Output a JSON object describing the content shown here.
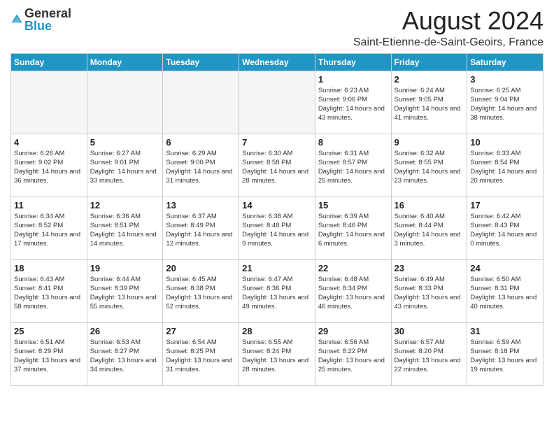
{
  "header": {
    "logo_general": "General",
    "logo_blue": "Blue",
    "month_title": "August 2024",
    "location": "Saint-Etienne-de-Saint-Geoirs, France"
  },
  "weekdays": [
    "Sunday",
    "Monday",
    "Tuesday",
    "Wednesday",
    "Thursday",
    "Friday",
    "Saturday"
  ],
  "weeks": [
    [
      {
        "day": "",
        "info": ""
      },
      {
        "day": "",
        "info": ""
      },
      {
        "day": "",
        "info": ""
      },
      {
        "day": "",
        "info": ""
      },
      {
        "day": "1",
        "info": "Sunrise: 6:23 AM\nSunset: 9:06 PM\nDaylight: 14 hours and 43 minutes."
      },
      {
        "day": "2",
        "info": "Sunrise: 6:24 AM\nSunset: 9:05 PM\nDaylight: 14 hours and 41 minutes."
      },
      {
        "day": "3",
        "info": "Sunrise: 6:25 AM\nSunset: 9:04 PM\nDaylight: 14 hours and 38 minutes."
      }
    ],
    [
      {
        "day": "4",
        "info": "Sunrise: 6:26 AM\nSunset: 9:02 PM\nDaylight: 14 hours and 36 minutes."
      },
      {
        "day": "5",
        "info": "Sunrise: 6:27 AM\nSunset: 9:01 PM\nDaylight: 14 hours and 33 minutes."
      },
      {
        "day": "6",
        "info": "Sunrise: 6:29 AM\nSunset: 9:00 PM\nDaylight: 14 hours and 31 minutes."
      },
      {
        "day": "7",
        "info": "Sunrise: 6:30 AM\nSunset: 8:58 PM\nDaylight: 14 hours and 28 minutes."
      },
      {
        "day": "8",
        "info": "Sunrise: 6:31 AM\nSunset: 8:57 PM\nDaylight: 14 hours and 25 minutes."
      },
      {
        "day": "9",
        "info": "Sunrise: 6:32 AM\nSunset: 8:55 PM\nDaylight: 14 hours and 23 minutes."
      },
      {
        "day": "10",
        "info": "Sunrise: 6:33 AM\nSunset: 8:54 PM\nDaylight: 14 hours and 20 minutes."
      }
    ],
    [
      {
        "day": "11",
        "info": "Sunrise: 6:34 AM\nSunset: 8:52 PM\nDaylight: 14 hours and 17 minutes."
      },
      {
        "day": "12",
        "info": "Sunrise: 6:36 AM\nSunset: 8:51 PM\nDaylight: 14 hours and 14 minutes."
      },
      {
        "day": "13",
        "info": "Sunrise: 6:37 AM\nSunset: 8:49 PM\nDaylight: 14 hours and 12 minutes."
      },
      {
        "day": "14",
        "info": "Sunrise: 6:38 AM\nSunset: 8:48 PM\nDaylight: 14 hours and 9 minutes."
      },
      {
        "day": "15",
        "info": "Sunrise: 6:39 AM\nSunset: 8:46 PM\nDaylight: 14 hours and 6 minutes."
      },
      {
        "day": "16",
        "info": "Sunrise: 6:40 AM\nSunset: 8:44 PM\nDaylight: 14 hours and 3 minutes."
      },
      {
        "day": "17",
        "info": "Sunrise: 6:42 AM\nSunset: 8:43 PM\nDaylight: 14 hours and 0 minutes."
      }
    ],
    [
      {
        "day": "18",
        "info": "Sunrise: 6:43 AM\nSunset: 8:41 PM\nDaylight: 13 hours and 58 minutes."
      },
      {
        "day": "19",
        "info": "Sunrise: 6:44 AM\nSunset: 8:39 PM\nDaylight: 13 hours and 55 minutes."
      },
      {
        "day": "20",
        "info": "Sunrise: 6:45 AM\nSunset: 8:38 PM\nDaylight: 13 hours and 52 minutes."
      },
      {
        "day": "21",
        "info": "Sunrise: 6:47 AM\nSunset: 8:36 PM\nDaylight: 13 hours and 49 minutes."
      },
      {
        "day": "22",
        "info": "Sunrise: 6:48 AM\nSunset: 8:34 PM\nDaylight: 13 hours and 46 minutes."
      },
      {
        "day": "23",
        "info": "Sunrise: 6:49 AM\nSunset: 8:33 PM\nDaylight: 13 hours and 43 minutes."
      },
      {
        "day": "24",
        "info": "Sunrise: 6:50 AM\nSunset: 8:31 PM\nDaylight: 13 hours and 40 minutes."
      }
    ],
    [
      {
        "day": "25",
        "info": "Sunrise: 6:51 AM\nSunset: 8:29 PM\nDaylight: 13 hours and 37 minutes."
      },
      {
        "day": "26",
        "info": "Sunrise: 6:53 AM\nSunset: 8:27 PM\nDaylight: 13 hours and 34 minutes."
      },
      {
        "day": "27",
        "info": "Sunrise: 6:54 AM\nSunset: 8:25 PM\nDaylight: 13 hours and 31 minutes."
      },
      {
        "day": "28",
        "info": "Sunrise: 6:55 AM\nSunset: 8:24 PM\nDaylight: 13 hours and 28 minutes."
      },
      {
        "day": "29",
        "info": "Sunrise: 6:56 AM\nSunset: 8:22 PM\nDaylight: 13 hours and 25 minutes."
      },
      {
        "day": "30",
        "info": "Sunrise: 6:57 AM\nSunset: 8:20 PM\nDaylight: 13 hours and 22 minutes."
      },
      {
        "day": "31",
        "info": "Sunrise: 6:59 AM\nSunset: 8:18 PM\nDaylight: 13 hours and 19 minutes."
      }
    ]
  ]
}
